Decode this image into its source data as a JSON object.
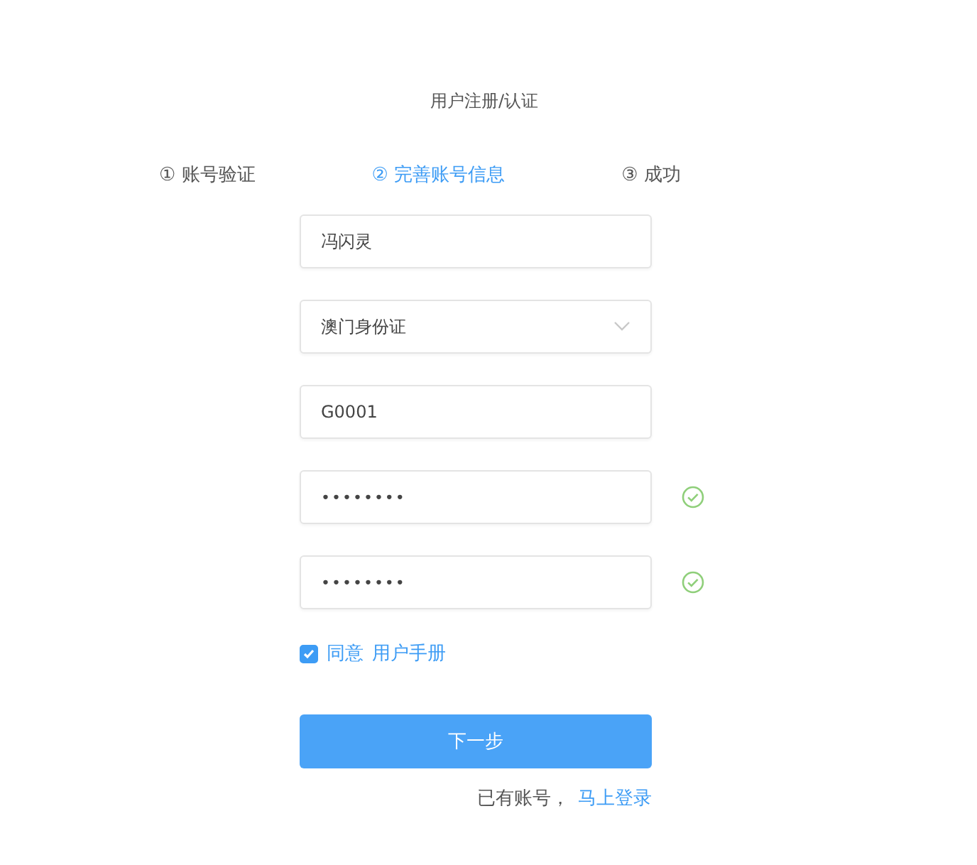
{
  "title": "用户注册/认证",
  "steps": [
    {
      "number": "①",
      "label": "账号验证",
      "selected": false
    },
    {
      "number": "②",
      "label": "完善账号信息",
      "selected": true
    },
    {
      "number": "③",
      "label": "成功",
      "selected": false
    }
  ],
  "fields": [
    {
      "kind": "text",
      "value": "冯闪灵",
      "valid": false
    },
    {
      "kind": "select",
      "value": "澳门身份证",
      "valid": false
    },
    {
      "kind": "text",
      "value": "G0001",
      "valid": false
    },
    {
      "kind": "password",
      "value": "••••••••",
      "valid": true
    },
    {
      "kind": "password",
      "value": "••••••••",
      "valid": true
    }
  ],
  "agreement": {
    "checked": true,
    "label": "同意",
    "link": "用户手册"
  },
  "submit": "下一步",
  "footer": {
    "text": "已有账号，",
    "link": "马上登录"
  }
}
